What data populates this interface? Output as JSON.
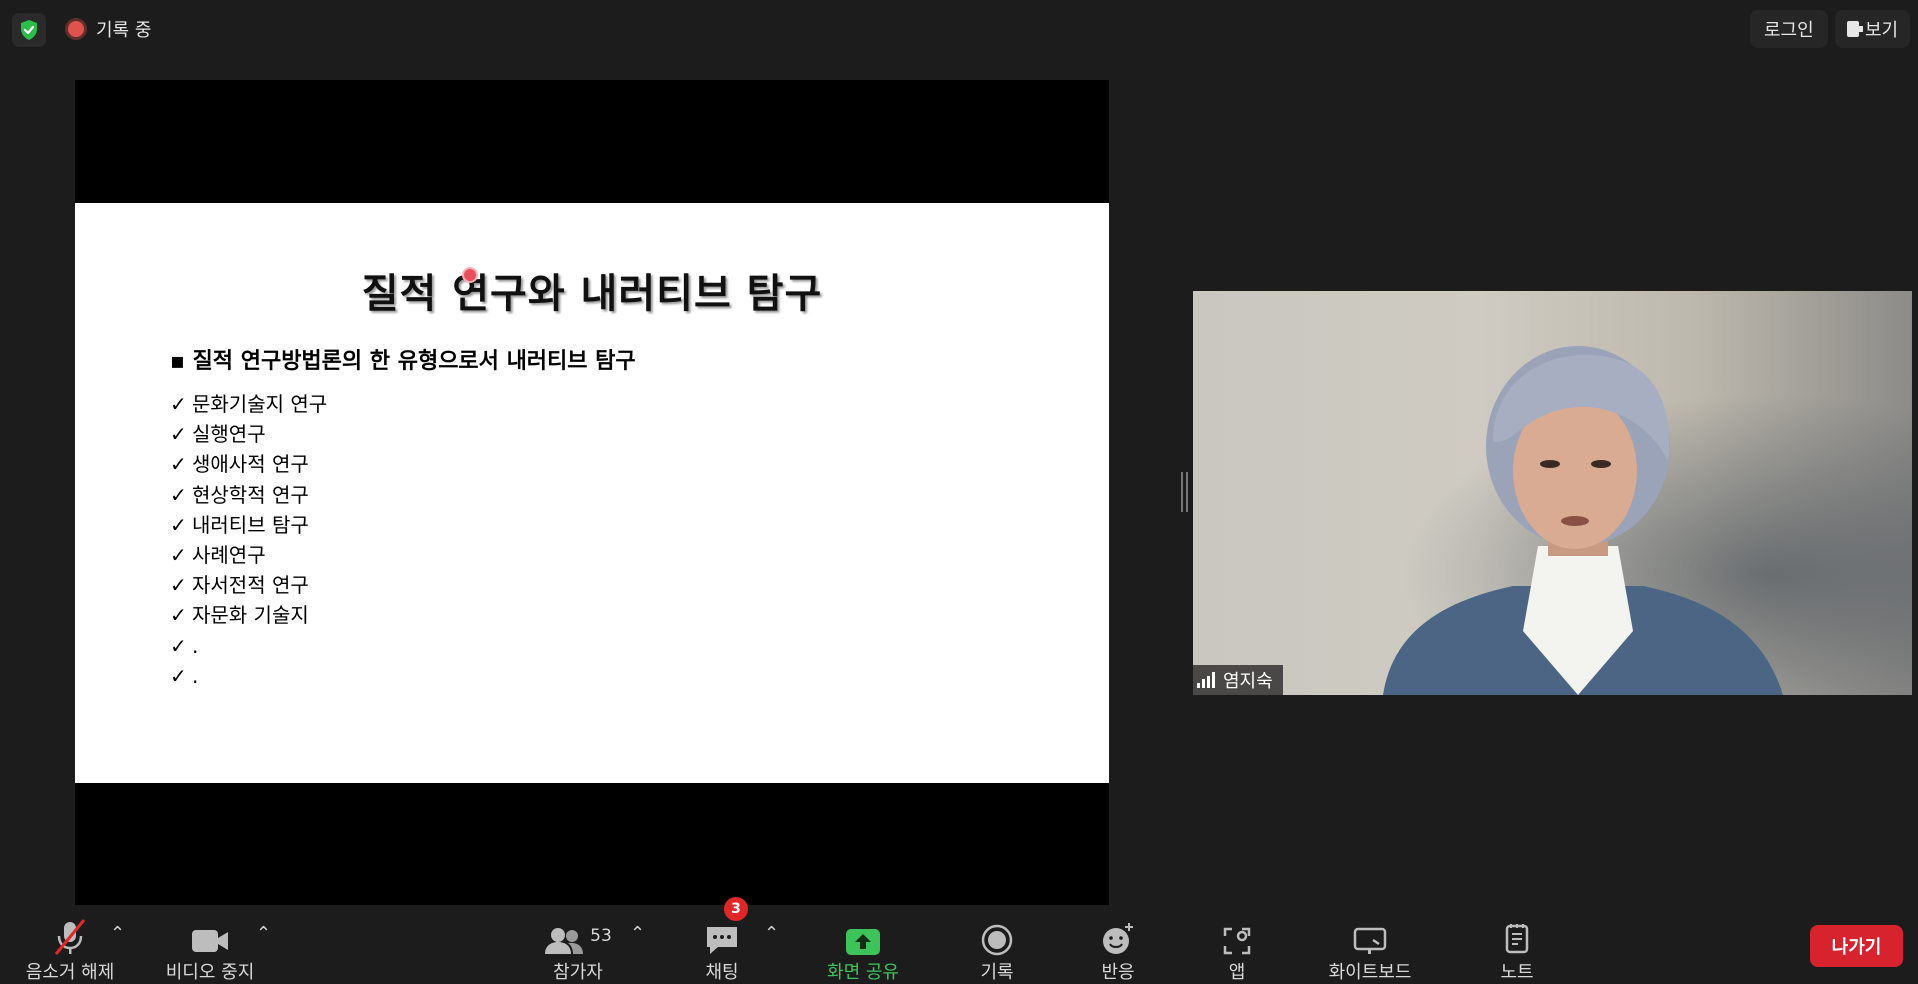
{
  "topbar": {
    "recording_label": "기록 중",
    "login_label": "로그인",
    "view_label": "보기"
  },
  "slide": {
    "title": "질적 연구와 내러티브 탐구",
    "subtitle": "▪ 질적 연구방법론의 한 유형으로서 내러티브 탐구",
    "check_mark": "✓",
    "items": [
      "문화기술지 연구",
      "실행연구",
      "생애사적 연구",
      "현상학적 연구",
      "내러티브 탐구",
      "사례연구",
      "자서전적 연구",
      "자문화 기술지",
      ".",
      "."
    ]
  },
  "video": {
    "participant_name": "염지숙"
  },
  "toolbar": {
    "unmute_label": "음소거 해제",
    "stop_video_label": "비디오 중지",
    "participants_label": "참가자",
    "participants_count": "53",
    "chat_label": "채팅",
    "chat_badge": "3",
    "share_label": "화면 공유",
    "record_label": "기록",
    "reactions_label": "반응",
    "apps_label": "앱",
    "whiteboard_label": "화이트보드",
    "notes_label": "노트",
    "leave_label": "나가기",
    "caret": "⌃"
  },
  "colors": {
    "background": "#1c1c1c",
    "share_green": "#3cc45a",
    "leave_red": "#d6232e",
    "badge_red": "#e02828",
    "recording_red": "#e0524c",
    "shield_green": "#2bbf4a"
  }
}
